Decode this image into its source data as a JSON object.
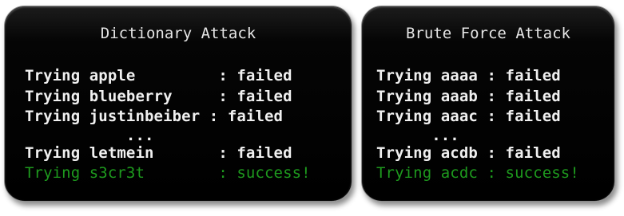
{
  "dictionary": {
    "title": "Dictionary Attack",
    "lines": [
      "Trying apple         : failed",
      "Trying blueberry     : failed",
      "Trying justinbeiber : failed",
      "           ...",
      "Trying letmein       : failed",
      "Trying s3cr3t        : success!"
    ]
  },
  "brute_force": {
    "title": "Brute Force Attack",
    "lines": [
      "Trying aaaa : failed",
      "Trying aaab : failed",
      "Trying aaac : failed",
      "      ...",
      "Trying acdb : failed",
      "Trying acdc : success!"
    ]
  },
  "colors": {
    "text": "#f0f0f0",
    "success": "#1e9a1e",
    "panel_bg": "#000000"
  }
}
